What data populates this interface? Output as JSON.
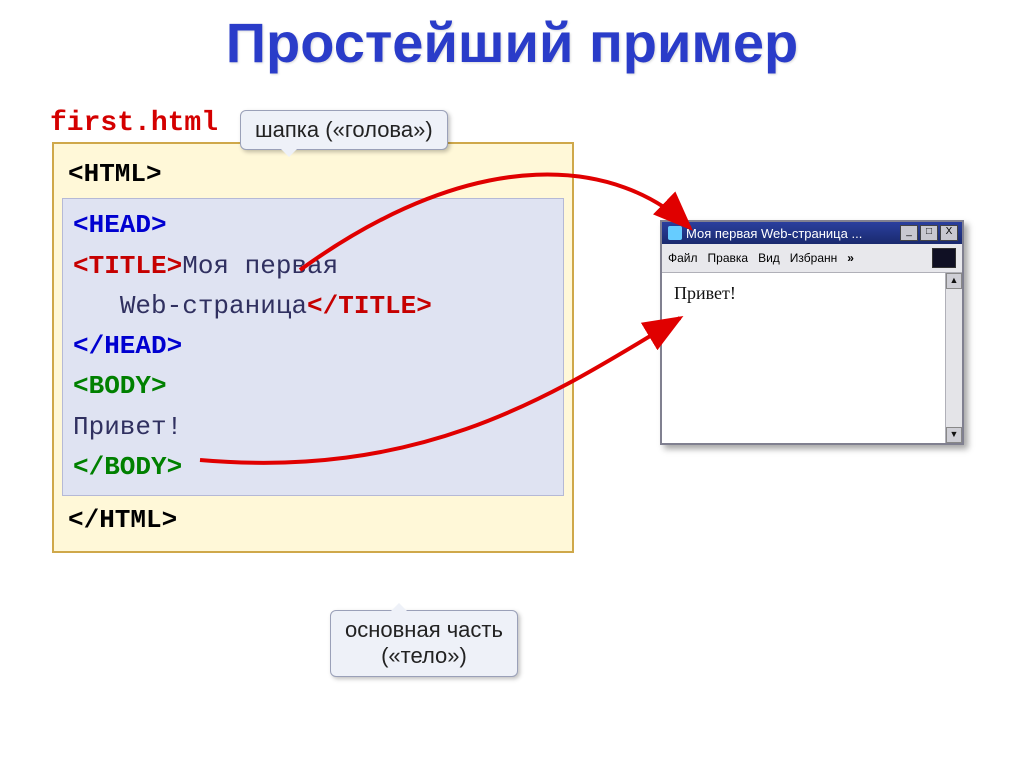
{
  "title": "Простейший пример",
  "filename": "first.html",
  "code": {
    "html_open": "<HTML>",
    "head_open": "<HEAD>",
    "title_open": "<TITLE>",
    "title_text_l1": "Моя первая",
    "title_text_l2": "Web-страница",
    "title_close": "</TITLE>",
    "head_close": "</HEAD>",
    "body_open": "<BODY>",
    "body_text": "Привет!",
    "body_close": "</BODY>",
    "html_close": "</HTML>"
  },
  "callouts": {
    "head": "шапка («голова»)",
    "body_l1": "основная часть",
    "body_l2": "(«тело»)"
  },
  "browser": {
    "window_title": "Моя первая Web-страница ...",
    "btn_min": "_",
    "btn_max": "□",
    "btn_close": "X",
    "menu": {
      "file": "Файл",
      "edit": "Правка",
      "view": "Вид",
      "favorites": "Избранн",
      "chevron": "»"
    },
    "content": "Привет!",
    "scroll_up": "▲",
    "scroll_down": "▼"
  }
}
